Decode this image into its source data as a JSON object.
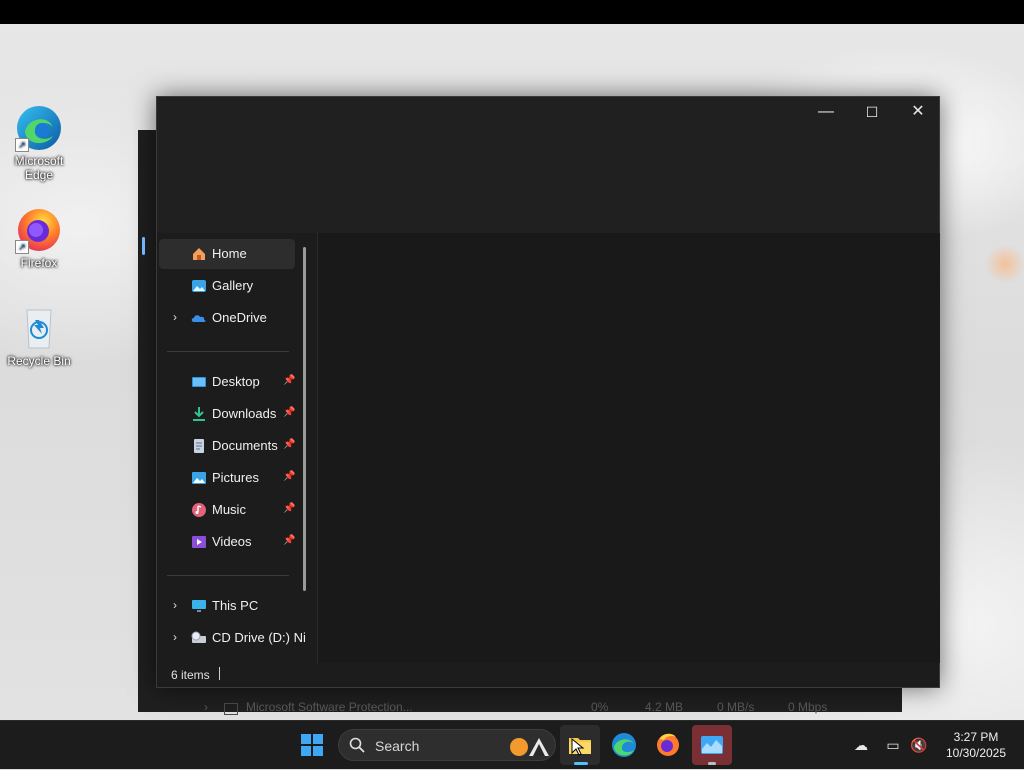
{
  "desktop": {
    "icons": [
      {
        "label": "Microsoft Edge",
        "icon": "edge-icon"
      },
      {
        "label": "Firefox",
        "icon": "firefox-icon"
      },
      {
        "label": "Recycle Bin",
        "icon": "recycle-bin-icon"
      }
    ]
  },
  "back_window": {
    "row": {
      "name": "Microsoft Software Protection...",
      "cpu": "0%",
      "memory": "4.2 MB",
      "disk": "0 MB/s",
      "network": "0 Mbps"
    }
  },
  "explorer": {
    "controls": {
      "minimize": "—",
      "maximize": "☐",
      "close": "✕"
    },
    "nav": {
      "quick": [
        {
          "label": "Home",
          "icon": "home-icon",
          "expandable": false
        },
        {
          "label": "Gallery",
          "icon": "gallery-icon",
          "expandable": false
        },
        {
          "label": "OneDrive",
          "icon": "cloud-icon",
          "expandable": true
        }
      ],
      "pinned": [
        {
          "label": "Desktop",
          "icon": "desktop-folder-icon"
        },
        {
          "label": "Downloads",
          "icon": "download-icon"
        },
        {
          "label": "Documents",
          "icon": "documents-icon"
        },
        {
          "label": "Pictures",
          "icon": "pictures-icon"
        },
        {
          "label": "Music",
          "icon": "music-icon"
        },
        {
          "label": "Videos",
          "icon": "videos-icon"
        }
      ],
      "drives": [
        {
          "label": "This PC",
          "icon": "computer-icon"
        },
        {
          "label": "CD Drive (D:) Ni",
          "icon": "cd-drive-icon"
        }
      ]
    },
    "status": {
      "items": "6 items"
    }
  },
  "taskbar": {
    "search_label": "Search",
    "apps": [
      "start-icon",
      "file-explorer-icon",
      "edge-icon",
      "firefox-icon",
      "task-manager-icon"
    ],
    "time": "3:27 PM",
    "date": "10/30/2025"
  },
  "colors": {
    "accent": "#4cc2ff",
    "explorer_bg": "#1c1c1c",
    "taskbar_bg": "#1c1c1c"
  }
}
